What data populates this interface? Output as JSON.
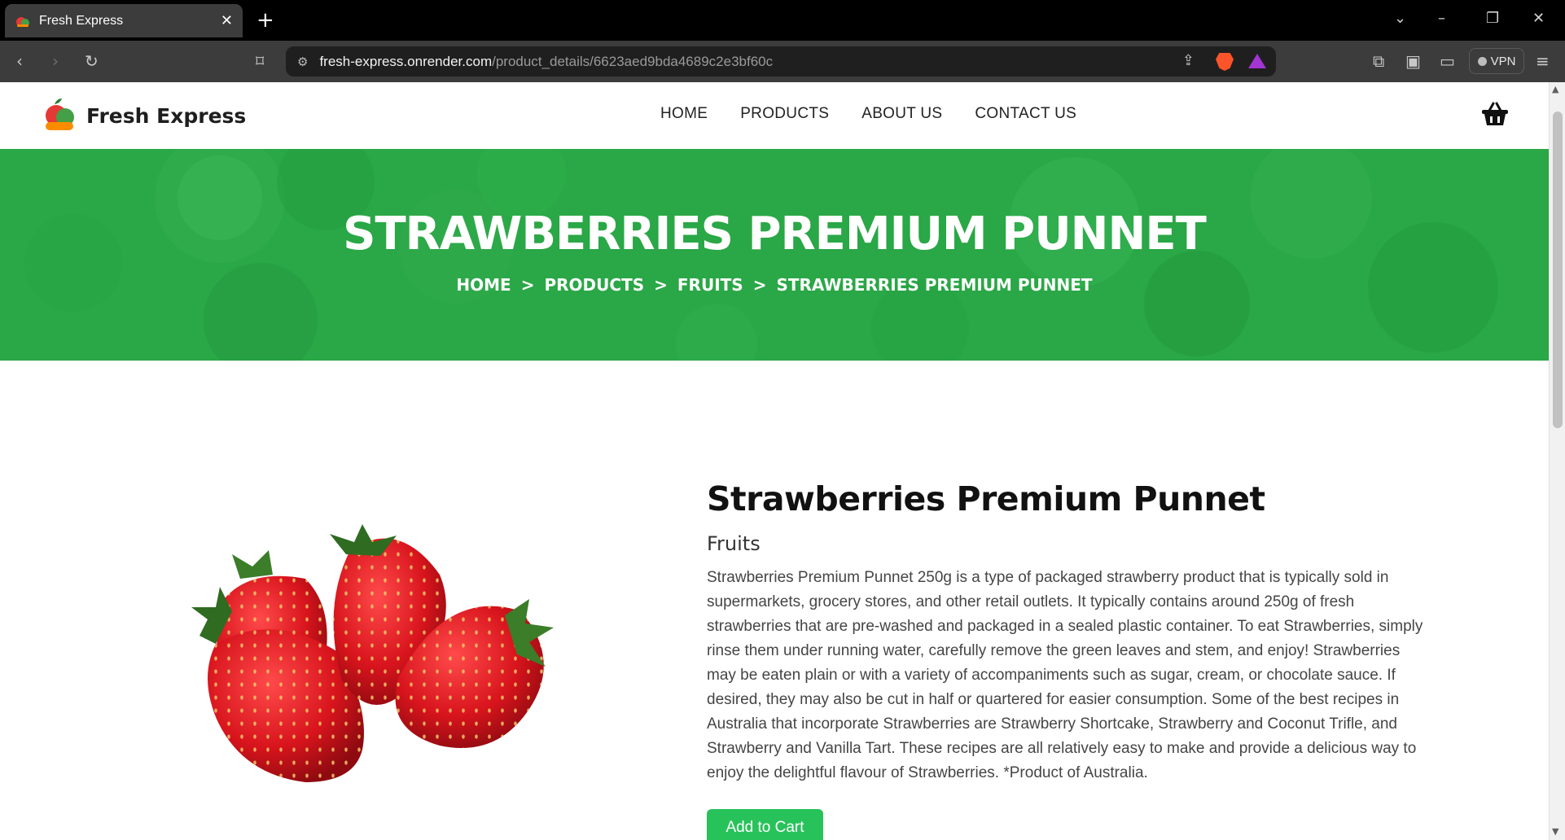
{
  "browser": {
    "tab_title": "Fresh Express",
    "url_host": "fresh-express.onrender.com",
    "url_path": "/product_details/6623aed9bda4689c2e3bf60c",
    "vpn_label": "VPN"
  },
  "site": {
    "brand": "Fresh Express",
    "nav": [
      "HOME",
      "PRODUCTS",
      "ABOUT US",
      "CONTACT US"
    ],
    "accent_green": "#2aa746",
    "button_green": "#28c25a"
  },
  "hero": {
    "title": "STRAWBERRIES PREMIUM PUNNET",
    "breadcrumb": [
      "HOME",
      "PRODUCTS",
      "FRUITS",
      "STRAWBERRIES PREMIUM PUNNET"
    ],
    "separator": ">"
  },
  "product": {
    "name": "Strawberries Premium Punnet",
    "category": "Fruits",
    "description": "Strawberries Premium Punnet 250g is a type of packaged strawberry product that is typically sold in supermarkets, grocery stores, and other retail outlets. It typically contains around 250g of fresh strawberries that are pre-washed and packaged in a sealed plastic container. To eat Strawberries, simply rinse them under running water, carefully remove the green leaves and stem, and enjoy! Strawberries may be eaten plain or with a variety of accompaniments such as sugar, cream, or chocolate sauce. If desired, they may also be cut in half or quartered for easier consumption. Some of the best recipes in Australia that incorporate Strawberries are Strawberry Shortcake, Strawberry and Coconut Trifle, and Strawberry and Vanilla Tart. These recipes are all relatively easy to make and provide a delicious way to enjoy the delightful flavour of Strawberries. *Product of Australia.",
    "add_to_cart_label": "Add to Cart"
  }
}
